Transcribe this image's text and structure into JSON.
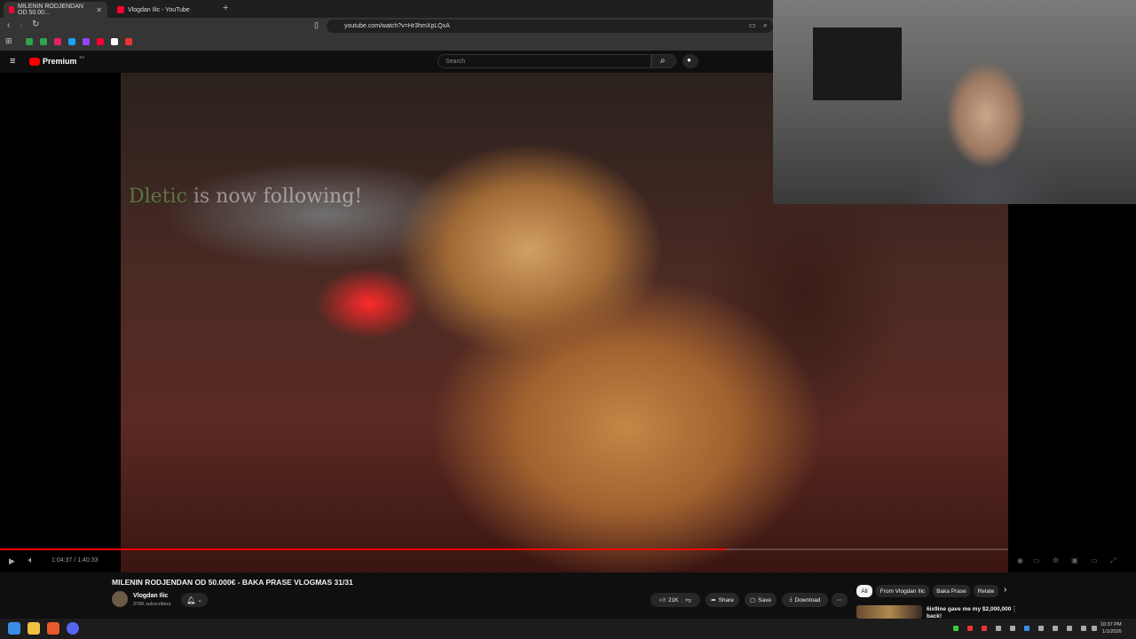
{
  "browser": {
    "tabs": [
      {
        "label": "MILENIN RODJENDAN OD 50.00...",
        "active": true
      },
      {
        "label": "Vlogdan Ilic - YouTube",
        "active": false
      }
    ],
    "new_tab": "+",
    "url": "youtube.com/watch?v=Hr3hmXpLQxA"
  },
  "youtube": {
    "logo": "Premium",
    "logo_superscript": "RS",
    "search_placeholder": "Search"
  },
  "video": {
    "overlay_user": "Dletic",
    "overlay_text": " is now following!",
    "time": "1:04:37 / 1:40:33",
    "progress": 0.72
  },
  "info": {
    "title": "MILENIN RODJENDAN OD 50.000€ - BAKA PRASE VLOGMAS 31/31",
    "channel": "Vlogdan Ilic",
    "subscribers": "376K subscribers",
    "likes": "21K",
    "share": "Share",
    "save": "Save",
    "download": "Download",
    "more": "⋯"
  },
  "sidebar_chips": [
    "All",
    "From Vlogdan Ilic",
    "Baka Prase",
    "Relate"
  ],
  "recommended": {
    "title": "6ix9ine gave me my $2,000,000 back!"
  },
  "taskbar": {
    "time": "10:37 PM",
    "date": "1/1/2026"
  },
  "icons": {
    "menu": "hamburger-icon",
    "search": "search-icon",
    "mic": "mic-icon",
    "play": "play-icon",
    "volume": "volume-icon",
    "bell": "bell-icon",
    "like": "thumb-up-icon",
    "dislike": "thumb-down-icon",
    "share": "share-icon",
    "save": "save-icon",
    "download": "download-icon"
  },
  "colors": {
    "accent": "#ff0000",
    "bg": "#0f0f0f",
    "chip": "#272727"
  }
}
